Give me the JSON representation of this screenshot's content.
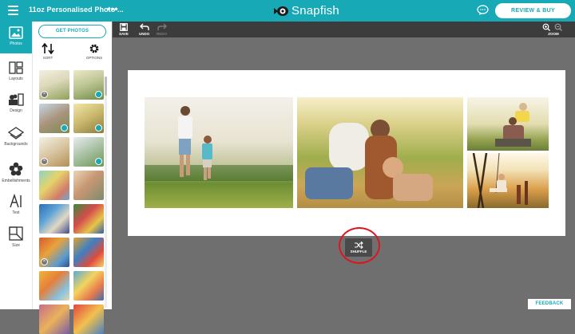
{
  "header": {
    "title": "11oz Personalised Photo ...",
    "more": "•••",
    "logo_text": "Snapfish",
    "review_buy": "REVIEW & BUY",
    "brand_color": "#17a9b6"
  },
  "rail": {
    "photos": "Photos",
    "layouts": "Layouts",
    "design": "Design",
    "backgrounds": "Backgrounds",
    "embellishments": "Embellishments",
    "text": "Text",
    "size": "Size"
  },
  "panel": {
    "get_photos": "GET PHOTOS",
    "sort": "SORT",
    "options": "OPTIONS"
  },
  "toolbar": {
    "save": "SAVE",
    "undo": "UNDO",
    "redo": "REDO",
    "zoom": "ZOOM"
  },
  "canvas": {
    "shuffle": "SHUFFLE"
  },
  "footer": {
    "feedback": "FEEDBACK"
  }
}
